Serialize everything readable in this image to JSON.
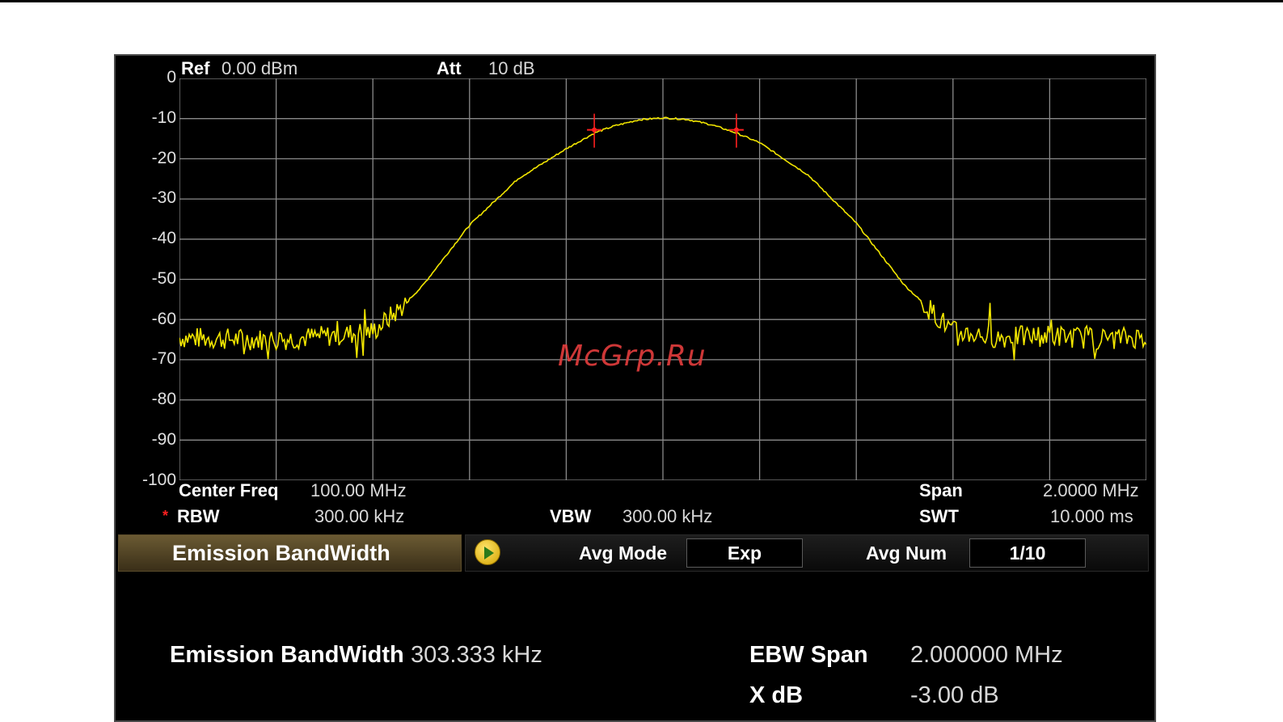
{
  "header": {
    "ref_label": "Ref",
    "ref_value": "0.00 dBm",
    "att_label": "Att",
    "att_value": "10 dB"
  },
  "y_axis": {
    "ticks": [
      "0",
      "-10",
      "-20",
      "-30",
      "-40",
      "-50",
      "-60",
      "-70",
      "-80",
      "-90",
      "-100"
    ]
  },
  "footer": {
    "center_freq_label": "Center Freq",
    "center_freq_value": "100.00 MHz",
    "span_label": "Span",
    "span_value": "2.0000 MHz",
    "rbw_marker": "*",
    "rbw_label": "RBW",
    "rbw_value": "300.00 kHz",
    "vbw_label": "VBW",
    "vbw_value": "300.00 kHz",
    "swt_label": "SWT",
    "swt_value": "10.000 ms"
  },
  "watermark": "McGrp.Ru",
  "measurement": {
    "title": "Emission BandWidth",
    "avg_mode_label": "Avg Mode",
    "avg_mode_value": "Exp",
    "avg_num_label": "Avg Num",
    "avg_num_value": "1/10"
  },
  "results": {
    "ebw_label": "Emission BandWidth",
    "ebw_value": "303.333 kHz",
    "ebw_span_label": "EBW Span",
    "ebw_span_value": "2.000000 MHz",
    "xdb_label": "X dB",
    "xdb_value": "-3.00 dB"
  },
  "colors": {
    "trace": "#f2e600",
    "grid": "#8a8a8a",
    "marker": "#ff2020",
    "background": "#000000"
  },
  "chart_data": {
    "type": "line",
    "y_range_dbm": [
      -100,
      0
    ],
    "x_range_mhz": [
      99.0,
      101.0
    ],
    "grid": true,
    "series": [
      {
        "x": [
          99.0,
          99.1,
          99.2,
          99.3,
          99.4,
          99.45,
          99.5,
          99.6,
          99.7,
          99.8,
          99.86,
          99.9,
          99.95,
          100.0,
          100.05,
          100.1,
          100.15,
          100.2,
          100.3,
          100.4,
          100.5,
          100.6,
          100.7,
          100.8,
          100.9,
          101.0
        ],
        "y": [
          -64.5,
          -64.8,
          -65.0,
          -64.2,
          -63.0,
          -58.0,
          -52.0,
          -36.5,
          -25.0,
          -17.5,
          -13.5,
          -11.8,
          -10.3,
          -9.8,
          -10.2,
          -11.5,
          -13.5,
          -16.0,
          -24.0,
          -36.0,
          -51.5,
          -63.0,
          -64.5,
          -64.0,
          -64.8,
          -64.3
        ]
      }
    ],
    "markers": [
      {
        "x": 99.858,
        "y": -12.8
      },
      {
        "x": 100.152,
        "y": -12.8
      }
    ]
  }
}
